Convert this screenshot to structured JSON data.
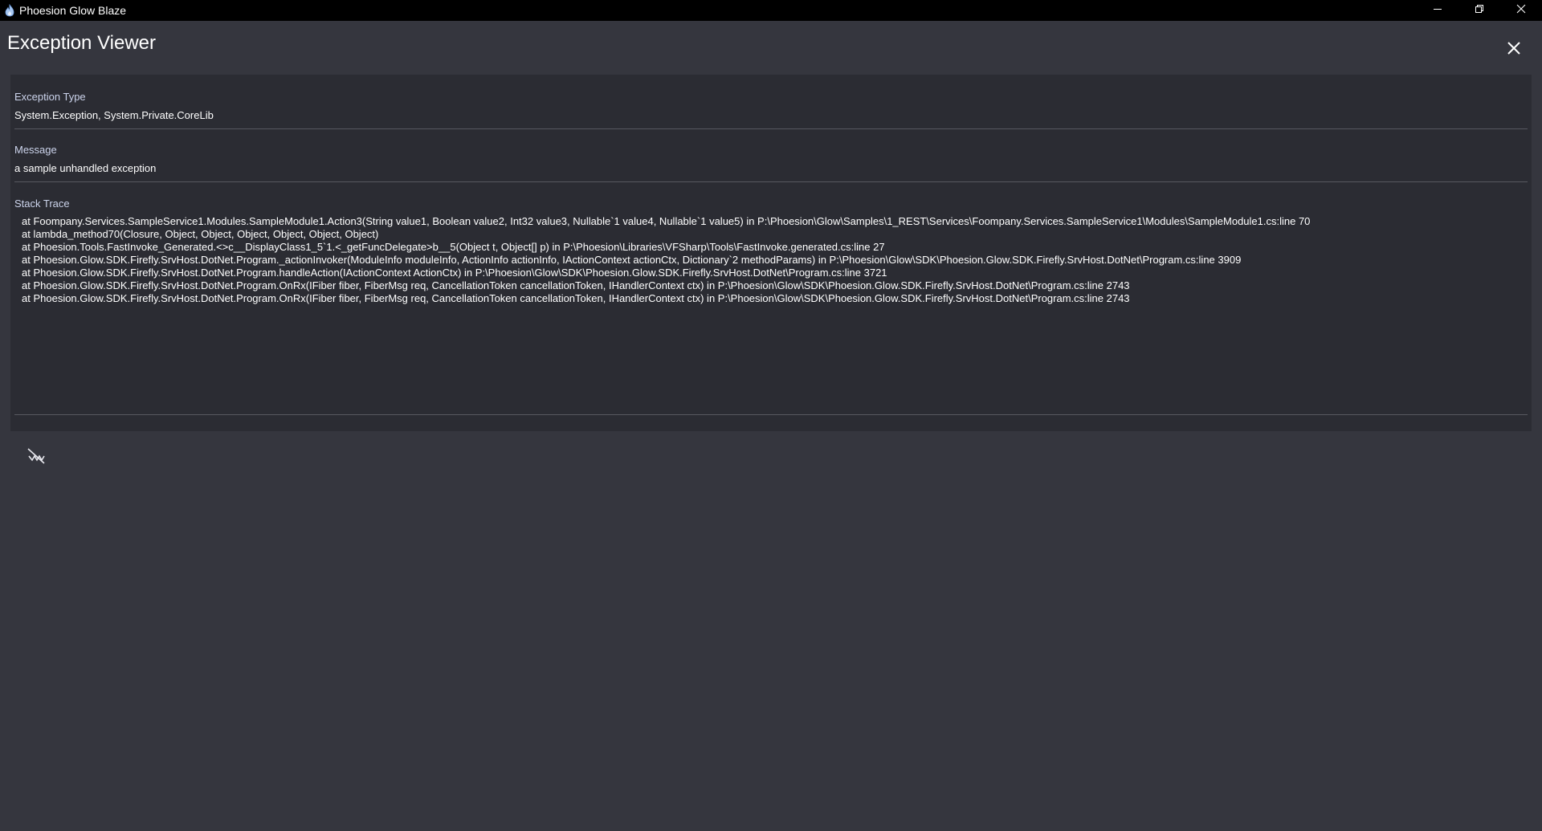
{
  "window": {
    "title": "Phoesion Glow Blaze",
    "icon": "flame-icon",
    "controls": [
      "minimize-icon",
      "restore-icon",
      "close-icon"
    ]
  },
  "dialog": {
    "title": "Exception Viewer",
    "close_icon": "close-icon"
  },
  "fields": {
    "exception_type": {
      "label": "Exception Type",
      "value": "System.Exception, System.Private.CoreLib"
    },
    "message": {
      "label": "Message",
      "value": "a sample unhandled exception"
    },
    "stack_trace": {
      "label": "Stack Trace",
      "lines": [
        "at Foompany.Services.SampleService1.Modules.SampleModule1.Action3(String value1, Boolean value2, Int32 value3, Nullable`1 value4, Nullable`1 value5) in P:\\Phoesion\\Glow\\Samples\\1_REST\\Services\\Foompany.Services.SampleService1\\Modules\\SampleModule1.cs:line 70",
        "at lambda_method70(Closure, Object, Object, Object, Object, Object, Object)",
        "at Phoesion.Tools.FastInvoke_Generated.<>c__DisplayClass1_5`1.<_getFuncDelegate>b__5(Object t, Object[] p) in P:\\Phoesion\\Libraries\\VFSharp\\Tools\\FastInvoke.generated.cs:line 27",
        "at Phoesion.Glow.SDK.Firefly.SrvHost.DotNet.Program._actionInvoker(ModuleInfo moduleInfo, ActionInfo actionInfo, IActionContext actionCtx, Dictionary`2 methodParams) in P:\\Phoesion\\Glow\\SDK\\Phoesion.Glow.SDK.Firefly.SrvHost.DotNet\\Program.cs:line 3909",
        "at Phoesion.Glow.SDK.Firefly.SrvHost.DotNet.Program.handleAction(IActionContext ActionCtx) in P:\\Phoesion\\Glow\\SDK\\Phoesion.Glow.SDK.Firefly.SrvHost.DotNet\\Program.cs:line 3721",
        "at Phoesion.Glow.SDK.Firefly.SrvHost.DotNet.Program.OnRx(IFiber fiber, FiberMsg req, CancellationToken cancellationToken, IHandlerContext ctx) in P:\\Phoesion\\Glow\\SDK\\Phoesion.Glow.SDK.Firefly.SrvHost.DotNet\\Program.cs:line 2743",
        "at Phoesion.Glow.SDK.Firefly.SrvHost.DotNet.Program.OnRx(IFiber fiber, FiberMsg req, CancellationToken cancellationToken, IHandlerContext ctx) in P:\\Phoesion\\Glow\\SDK\\Phoesion.Glow.SDK.Firefly.SrvHost.DotNet\\Program.cs:line 2743"
      ]
    }
  },
  "toolbar": {
    "icon": "text-wrap-icon"
  },
  "colors": {
    "background": "#35363e",
    "panel": "#2b2c33",
    "titlebar": "#000000",
    "label": "#ccd4ec",
    "text": "#ffffff",
    "divider": "#575860"
  }
}
